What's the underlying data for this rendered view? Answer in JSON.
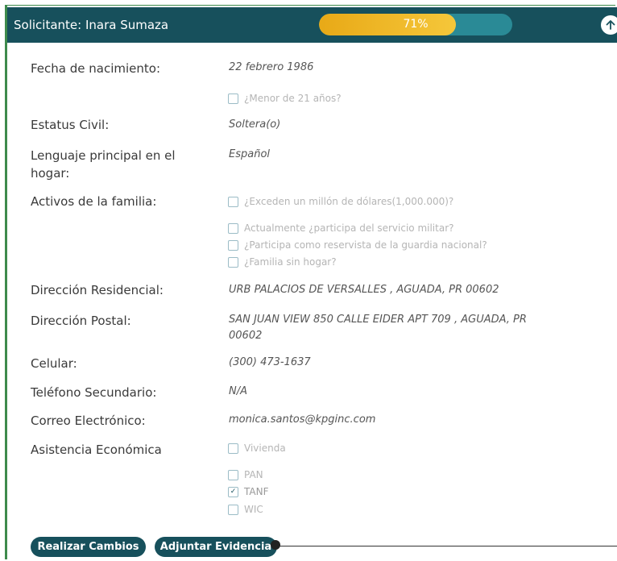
{
  "header": {
    "title": "Solicitante: Inara Sumaza",
    "progress_label": "71%",
    "progress_fraction": 0.71
  },
  "fields": {
    "birth_label": "Fecha de nacimiento:",
    "birth_value": "22 febrero 1986",
    "under21": "¿Menor de 21 años?",
    "civil_label": "Estatus Civil:",
    "civil_value": "Soltera(o)",
    "lang_label_1": "Lenguaje principal en el",
    "lang_label_2": "hogar:",
    "lang_value": "Español",
    "assets_label": "Activos de la familia:",
    "assets_q1": "¿Exceden un millón de dólares(1,000.000)?",
    "assets_q2": "Actualmente ¿participa del servicio militar?",
    "assets_q3": "¿Participa como reservista de la guardia nacional?",
    "assets_q4": "¿Familia sin hogar?",
    "res_label": "Dirección Residencial:",
    "res_value": "URB PALACIOS DE VERSALLES , AGUADA, PR 00602",
    "postal_label": "Dirección Postal:",
    "postal_value_1": "SAN JUAN VIEW 850 CALLE EIDER APT 709 , AGUADA, PR",
    "postal_value_2": "00602",
    "cell_label": "Celular:",
    "cell_value": "(300) 473-1637",
    "phone2_label": "Teléfono Secundario:",
    "phone2_value": "N/A",
    "email_label": "Correo Electrónico:",
    "email_value": "monica.santos@kpginc.com",
    "aid_label": "Asistencia Económica",
    "aid_vivienda": "Vivienda",
    "aid_pan": "PAN",
    "aid_tanf": "TANF",
    "aid_wic": "WIC"
  },
  "buttons": {
    "make_changes": "Realizar Cambios",
    "attach_evidence": "Adjuntar Evidencia"
  },
  "colors": {
    "header_bg": "#17505c",
    "progress_fill": "#e8a917",
    "progress_track": "#2a8a96"
  }
}
